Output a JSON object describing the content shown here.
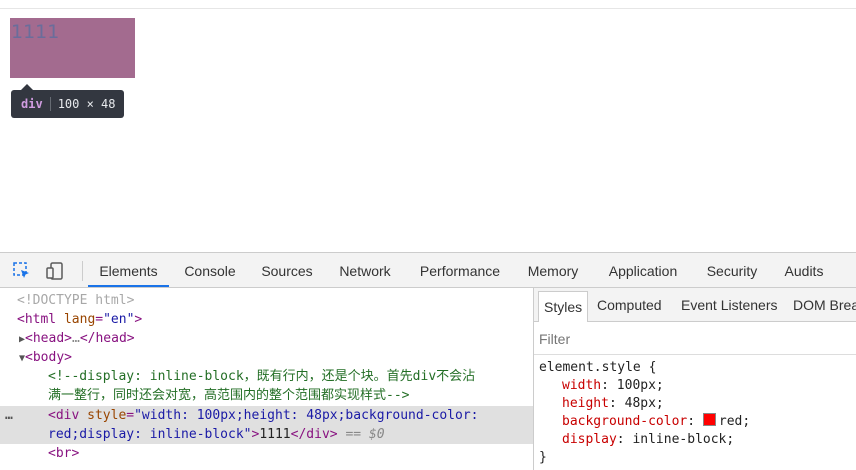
{
  "page": {
    "demo_text": "1111",
    "tooltip": {
      "tag": "div",
      "size": "100 × 48"
    },
    "box_color": "#a36b8f"
  },
  "devtools": {
    "toolbar": {
      "inspect_icon": "inspect-element-icon",
      "device_icon": "device-toolbar-icon",
      "tabs": [
        "Elements",
        "Console",
        "Sources",
        "Network",
        "Performance",
        "Memory",
        "Application",
        "Security",
        "Audits"
      ],
      "active_tab": "Elements",
      "accent": "#1a73e8"
    },
    "elements": {
      "doctype": "<!DOCTYPE html>",
      "html_open_tag": "html",
      "html_lang_attr": "lang",
      "html_lang_val": "\"en\"",
      "head_label": "head",
      "head_ellipsis": "…",
      "body_label": "body",
      "comment_line1": "<!--display: inline-block，既有行内，还是个块。首先div不会沾",
      "comment_line2": "满一整行，同时还会对宽，高范围内的整个范围都实现样式-->",
      "div_tag": "div",
      "div_style_attr": "style",
      "div_style_val_1": "\"width: 100px;height: 48px;background-color:",
      "div_style_val_2": "red;display: inline-block\"",
      "div_text": "1111",
      "div_eq": "== $0",
      "br_tag": "br",
      "selected_dots": "…"
    },
    "styles": {
      "subtabs": [
        "Styles",
        "Computed",
        "Event Listeners",
        "DOM Brea"
      ],
      "active_subtab": "Styles",
      "filter_placeholder": "Filter",
      "selector": "element.style {",
      "props": [
        {
          "name": "width",
          "value": "100px;"
        },
        {
          "name": "height",
          "value": "48px;"
        },
        {
          "name": "background-color",
          "value": "red;",
          "swatch": "#ff0000"
        },
        {
          "name": "display",
          "value": "inline-block;"
        }
      ],
      "close_brace": "}"
    }
  }
}
